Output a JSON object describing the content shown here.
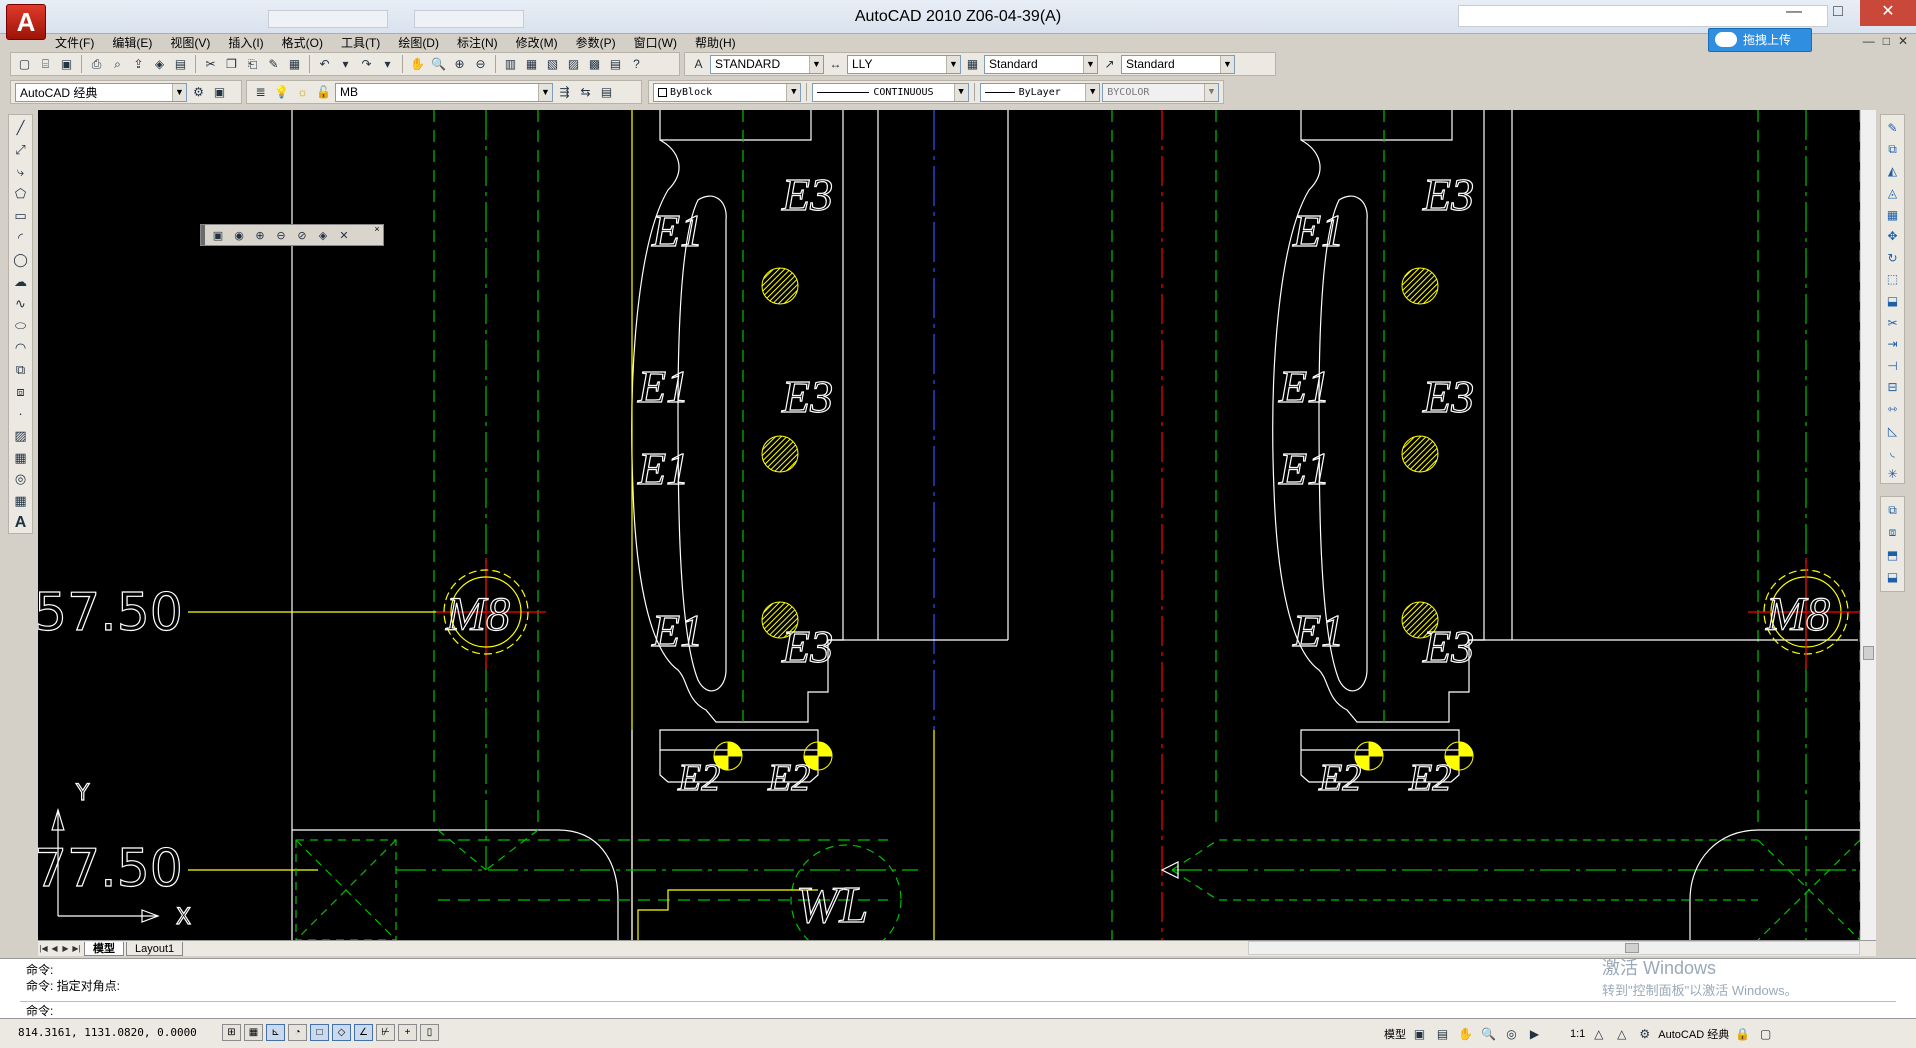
{
  "window": {
    "title": "AutoCAD 2010     Z06-04-39(A)",
    "logo_letter": "A",
    "upload_label": "拖拽上传",
    "controls": [
      "—",
      "□",
      "✕"
    ],
    "mdi_controls": [
      "—",
      "□",
      "✕"
    ]
  },
  "menu": [
    "文件(F)",
    "编辑(E)",
    "视图(V)",
    "插入(I)",
    "格式(O)",
    "工具(T)",
    "绘图(D)",
    "标注(N)",
    "修改(M)",
    "参数(P)",
    "窗口(W)",
    "帮助(H)"
  ],
  "styles": {
    "text_style": "STANDARD",
    "dim_style": "LLY",
    "table_style": "Standard",
    "mleader_style": "Standard"
  },
  "workspace": "AutoCAD 经典",
  "layer": {
    "name": "MB"
  },
  "properties": {
    "color": "ByBlock",
    "linetype": "CONTINUOUS",
    "lineweight": "ByLayer",
    "plotstyle": "BYCOLOR"
  },
  "drawing": {
    "dim_values": [
      "57.50",
      "77.50"
    ],
    "labels": {
      "e1": "E1",
      "e2": "E2",
      "e3": "E3",
      "m8": "M8",
      "wl": "WL"
    },
    "ucs": {
      "x": "X",
      "y": "Y"
    },
    "colors": {
      "background": "#000000",
      "white": "#ffffff",
      "green": "#00c000",
      "yellow": "#ffff00",
      "red": "#ff0000",
      "blue": "#0000ff"
    }
  },
  "layout_tabs": [
    "模型",
    "Layout1"
  ],
  "command": {
    "lines": [
      "命令:",
      "命令: 指定对角点:"
    ],
    "prompt": "命令:"
  },
  "watermark": {
    "line1": "激活 Windows",
    "line2": "转到\"控制面板\"以激活 Windows。"
  },
  "status": {
    "coordinates": "814.3161, 1131.0820, 0.0000",
    "model_label": "模型",
    "scale": "1:1",
    "workspace": "AutoCAD 经典"
  }
}
